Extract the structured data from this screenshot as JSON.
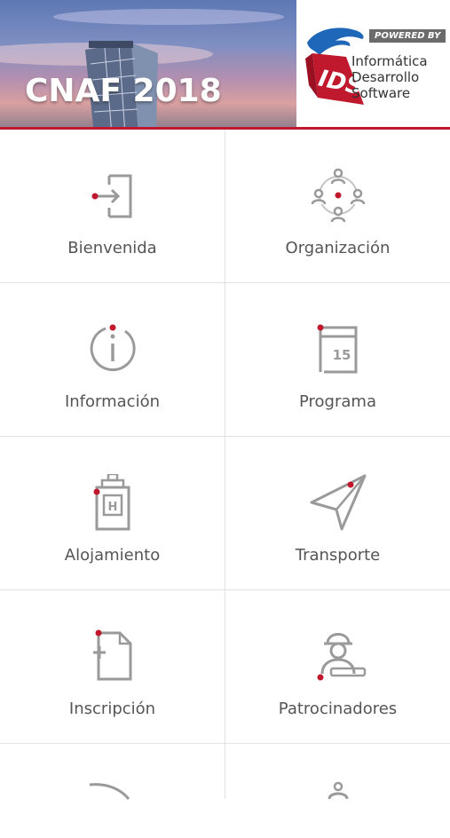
{
  "header": {
    "title": "CNAF 2018",
    "powered_by": "POWERED BY",
    "logo_letters": "IDS",
    "company_lines": [
      "Informática",
      "Desarrollo",
      "Software"
    ]
  },
  "colors": {
    "accent": "#c0182d",
    "icon_gray": "#9a9a9a",
    "label": "#555555"
  },
  "menu": [
    {
      "label": "Bienvenida",
      "icon": "login-icon"
    },
    {
      "label": "Organización",
      "icon": "people-network-icon"
    },
    {
      "label": "Información",
      "icon": "info-icon"
    },
    {
      "label": "Programa",
      "icon": "calendar-icon"
    },
    {
      "label": "Alojamiento",
      "icon": "hotel-icon"
    },
    {
      "label": "Transporte",
      "icon": "paper-plane-icon"
    },
    {
      "label": "Inscripción",
      "icon": "new-document-icon"
    },
    {
      "label": "Patrocinadores",
      "icon": "sponsor-icon"
    }
  ]
}
